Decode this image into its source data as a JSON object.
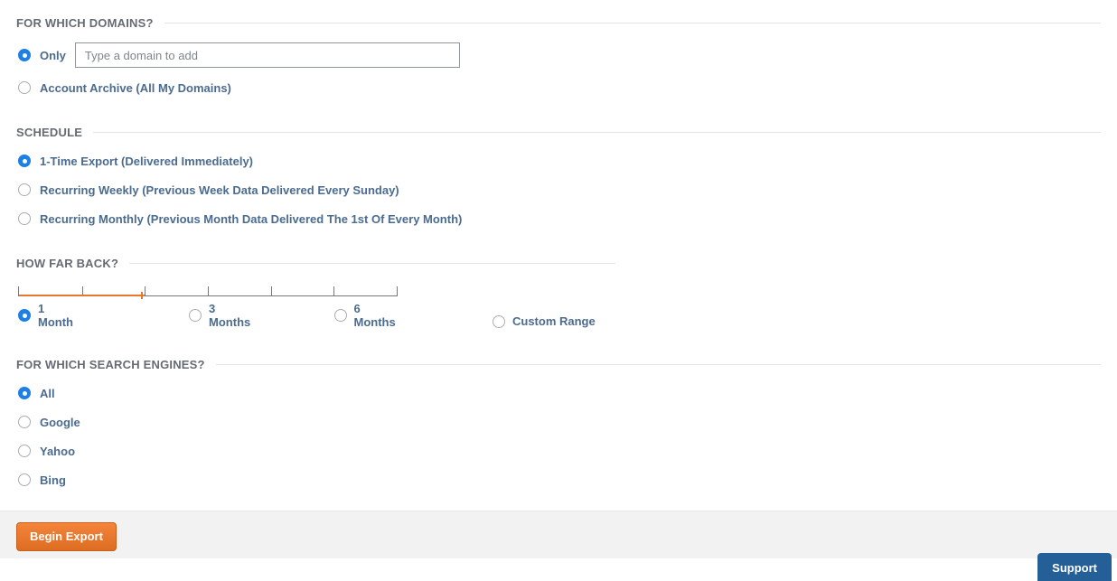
{
  "domains": {
    "legend": "FOR WHICH DOMAINS?",
    "only_label": "Only",
    "only_placeholder": "Type a domain to add",
    "only_value": "",
    "archive_label": "Account Archive (All My Domains)",
    "selected": "only"
  },
  "schedule": {
    "legend": "SCHEDULE",
    "one_time": "1-Time Export (Delivered Immediately)",
    "weekly": "Recurring Weekly (Previous Week Data Delivered Every Sunday)",
    "monthly": "Recurring Monthly (Previous Month Data Delivered The 1st Of Every Month)",
    "selected": "one_time"
  },
  "howfar": {
    "legend": "HOW FAR BACK?",
    "one_month": "1 Month",
    "three_months": "3 Months",
    "six_months": "6 Months",
    "custom": "Custom Range",
    "selected": "one_month"
  },
  "engines": {
    "legend": "FOR WHICH SEARCH ENGINES?",
    "all": "All",
    "google": "Google",
    "yahoo": "Yahoo",
    "bing": "Bing",
    "selected": "all"
  },
  "footer": {
    "submit": "Begin Export",
    "support": "Support"
  }
}
